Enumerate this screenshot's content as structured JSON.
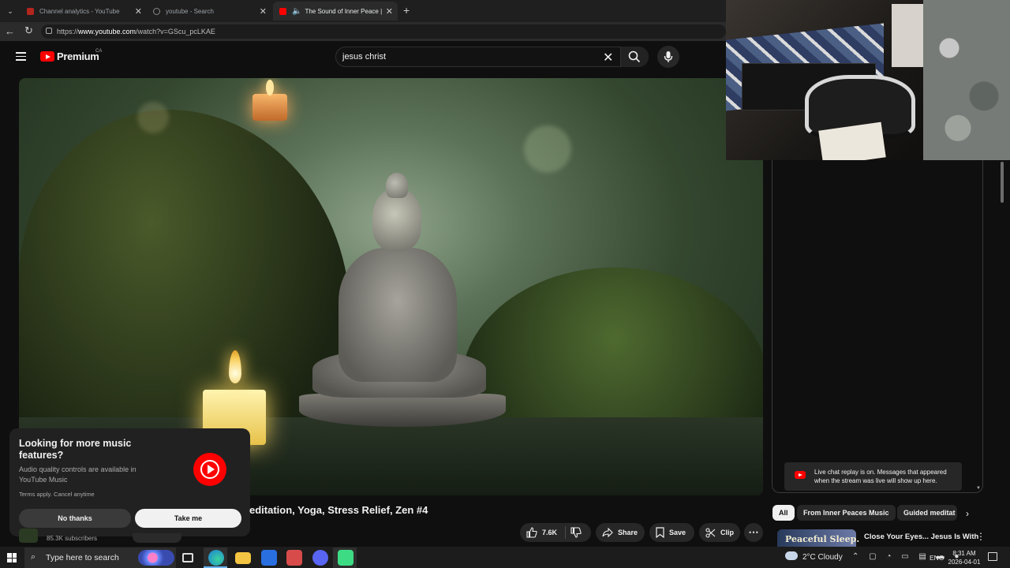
{
  "browser": {
    "tabs": [
      {
        "title": "Channel analytics - YouTube Studio",
        "active": false
      },
      {
        "title": "youtube - Search",
        "active": false
      },
      {
        "title": "The Sound of Inner Peace | Relaxing Music",
        "active": true
      }
    ],
    "url_scheme": "https://",
    "url_host": "www.youtube.com",
    "url_path": "/watch?v=GScu_pcLKAE"
  },
  "header": {
    "logo_text": "Premium",
    "country_code": "CA",
    "search_value": "jesus christ"
  },
  "popup": {
    "title": "Looking for more music features?",
    "description": "Audio quality controls are available in YouTube Music",
    "terms": "Terms apply. Cancel anytime",
    "no_thanks_label": "No thanks",
    "take_me_label": "Take me"
  },
  "video": {
    "title_visible": "editation, Yoga, Stress Relief, Zen #4",
    "subscribers": "85.3K subscribers",
    "likes": "7.6K",
    "share_label": "Share",
    "save_label": "Save",
    "clip_label": "Clip",
    "more_label": "⋯"
  },
  "chat": {
    "replay_message": "Live chat replay is on. Messages that appeared when the stream was live will show up here."
  },
  "chips": [
    "All",
    "From Inner Peaces Music",
    "Guided meditat"
  ],
  "recommendation": {
    "thumb_text": "Peaceful Sleep.",
    "title": "Close Your Eyes... Jesus Is With"
  },
  "taskbar": {
    "search_placeholder": "Type here to search",
    "weather": "2°C  Cloudy",
    "language": "ENG",
    "time": "8:31 AM",
    "date": "2026-04-01"
  },
  "colors": {
    "youtube_red": "#ff0000",
    "background": "#0f0f0f",
    "pill": "#272727"
  }
}
